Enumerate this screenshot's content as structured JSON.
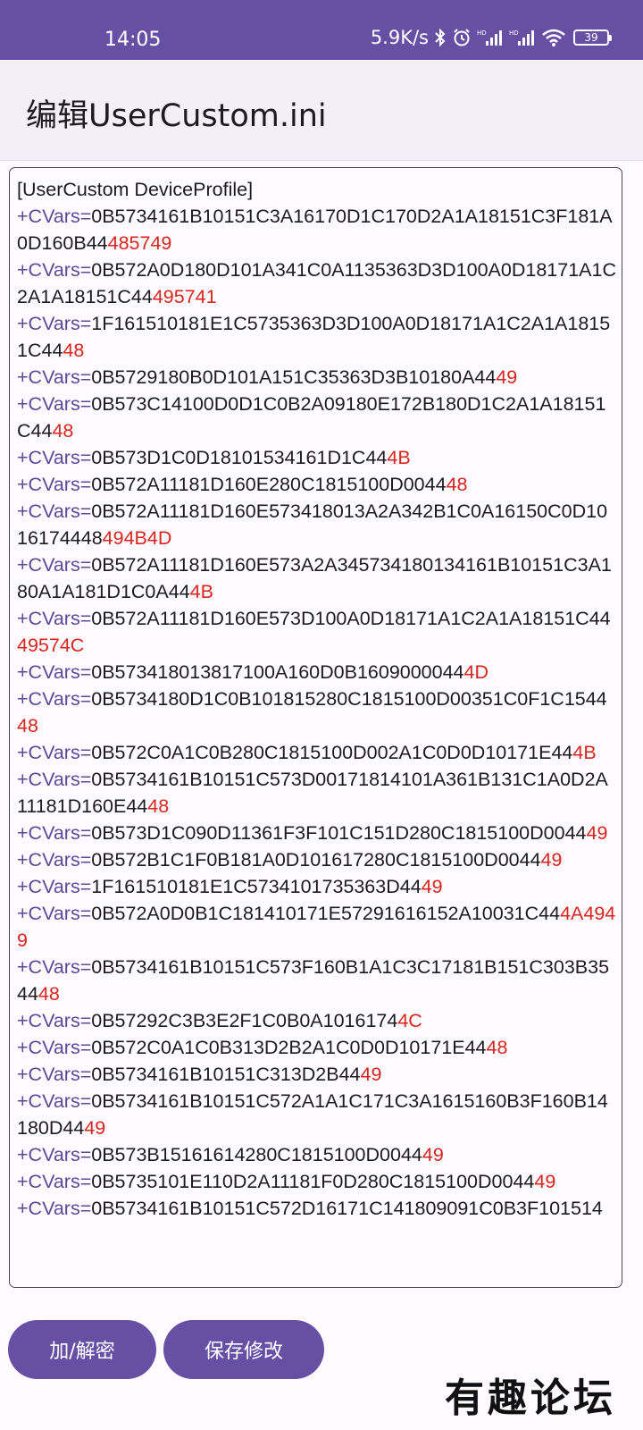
{
  "status_bar": {
    "time": "14:05",
    "speed": "5.9K/s",
    "battery": "39"
  },
  "app_bar": {
    "title": "编辑UserCustom.ini"
  },
  "editor": {
    "lines": [
      {
        "prefix": "",
        "hex": "[UserCustom DeviceProfile]",
        "suffix": ""
      },
      {
        "prefix": "+CVars=",
        "hex": "0B5734161B10151C3A16170D1C170D2A1A18151C3F181A0D160B44",
        "suffix": "485749"
      },
      {
        "prefix": "+CVars=",
        "hex": "0B572A0D180D101A341C0A1135363D3D100A0D18171A1C2A1A18151C44",
        "suffix": "495741"
      },
      {
        "prefix": "+CVars=",
        "hex": "1F161510181E1C5735363D3D100A0D18171A1C2A1A18151C44",
        "suffix": "48"
      },
      {
        "prefix": "+CVars=",
        "hex": "0B5729180B0D101A151C35363D3B10180A44",
        "suffix": "49"
      },
      {
        "prefix": "+CVars=",
        "hex": "0B573C14100D0D1C0B2A09180E172B180D1C2A1A18151C44",
        "suffix": "48"
      },
      {
        "prefix": "+CVars=",
        "hex": "0B573D1C0D18101534161D1C44",
        "suffix": "4B"
      },
      {
        "prefix": "+CVars=",
        "hex": "0B572A11181D160E280C1815100D0044",
        "suffix": "48"
      },
      {
        "prefix": "+CVars=",
        "hex": "0B572A11181D160E573418013A2A342B1C0A16150C0D1016174448",
        "suffix": "494B4D"
      },
      {
        "prefix": "+CVars=",
        "hex": "0B572A11181D160E573A2A345734180134161B10151C3A180A1A181D1C0A44",
        "suffix": "4B"
      },
      {
        "prefix": "+CVars=",
        "hex": "0B572A11181D160E573D100A0D18171A1C2A1A18151C44",
        "suffix": "49574C"
      },
      {
        "prefix": "+CVars=",
        "hex": "0B573418013817100A160D0B1609000044",
        "suffix": "4D"
      },
      {
        "prefix": "+CVars=",
        "hex": "0B5734180D1C0B101815280C1815100D00351C0F1C1544",
        "suffix": "48"
      },
      {
        "prefix": "+CVars=",
        "hex": "0B572C0A1C0B280C1815100D002A1C0D0D10171E44",
        "suffix": "4B"
      },
      {
        "prefix": "+CVars=",
        "hex": "0B5734161B10151C573D00171814101A361B131C1A0D2A11181D160E44",
        "suffix": "48"
      },
      {
        "prefix": "+CVars=",
        "hex": "0B573D1C090D11361F3F101C151D280C1815100D0044",
        "suffix": "49"
      },
      {
        "prefix": "+CVars=",
        "hex": "0B572B1C1F0B181A0D101617280C1815100D0044",
        "suffix": "49"
      },
      {
        "prefix": "+CVars=",
        "hex": "1F161510181E1C5734101735363D44",
        "suffix": "49"
      },
      {
        "prefix": "+CVars=",
        "hex": "0B572A0D0B1C181410171E57291616152A10031C44",
        "suffix": "4A4949"
      },
      {
        "prefix": "+CVars=",
        "hex": "0B5734161B10151C573F160B1A1C3C17181B151C303B3544",
        "suffix": "48"
      },
      {
        "prefix": "+CVars=",
        "hex": "0B57292C3B3E2F1C0B0A1016174",
        "suffix": "4C"
      },
      {
        "prefix": "+CVars=",
        "hex": "0B572C0A1C0B313D2B2A1C0D0D10171E44",
        "suffix": "48"
      },
      {
        "prefix": "+CVars=",
        "hex": "0B5734161B10151C313D2B44",
        "suffix": "49"
      },
      {
        "prefix": "+CVars=",
        "hex": "0B5734161B10151C572A1A1C171C3A1615160B3F160B14180D44",
        "suffix": "49"
      },
      {
        "prefix": "+CVars=",
        "hex": "0B573B15161614280C1815100D0044",
        "suffix": "49"
      },
      {
        "prefix": "+CVars=",
        "hex": "0B5735101E110D2A11181F0D280C1815100D0044",
        "suffix": "49"
      },
      {
        "prefix": "+CVars=",
        "hex": "0B5734161B10151C572D16171C141809091C0B3F101514",
        "suffix": ""
      }
    ]
  },
  "buttons": {
    "decrypt_label": "加/解密",
    "save_label": "保存修改"
  },
  "watermark": "有趣论坛"
}
